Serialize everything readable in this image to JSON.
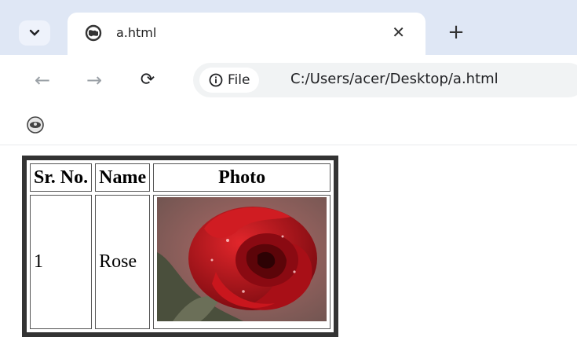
{
  "browser": {
    "tab": {
      "title": "a.html"
    },
    "address": {
      "chip_label": "File",
      "url": "C:/Users/acer/Desktop/a.html"
    }
  },
  "table": {
    "headers": [
      "Sr. No.",
      "Name",
      "Photo"
    ],
    "rows": [
      {
        "sr": "1",
        "name": "Rose",
        "photo": "rose-image"
      }
    ]
  },
  "colors": {
    "tabstrip": "#dfe7f5",
    "table_border": "#333333",
    "rose_red": "#c3121a"
  }
}
